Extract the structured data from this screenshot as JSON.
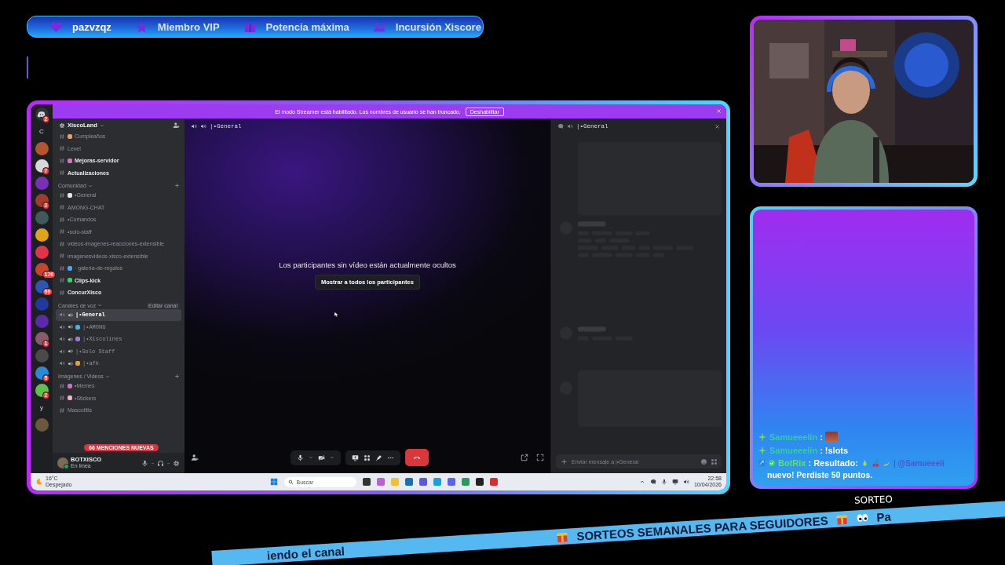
{
  "top_bar": {
    "items": [
      {
        "kind": "heart",
        "label": "pazvzqz",
        "selected": true
      },
      {
        "kind": "star",
        "label": "Miembro VIP",
        "selected": false
      },
      {
        "kind": "gift",
        "label": "Potencia máxima",
        "selected": false
      },
      {
        "kind": "group",
        "label": "Incursión Xiscore",
        "selected": false
      }
    ]
  },
  "discord": {
    "banner": {
      "text": "El modo Streamer está habilitado. Los nombres de usuario se han truncado.",
      "button": "Deshabilitar"
    },
    "servers": [
      {
        "kind": "home",
        "badge": "2"
      },
      {
        "kind": "letter",
        "label": "C"
      },
      {
        "kind": "avatar",
        "color": "#b5552e"
      },
      {
        "kind": "avatar",
        "color": "#d8d8d8",
        "badge": "7"
      },
      {
        "kind": "avatar",
        "color": "#7a2fb8"
      },
      {
        "kind": "avatar",
        "color": "#a33a2a",
        "badge": "3"
      },
      {
        "kind": "avatar",
        "color": "#3f5a5a"
      },
      {
        "kind": "avatar",
        "color": "#e0a516"
      },
      {
        "kind": "avatar",
        "color": "#e0344a"
      },
      {
        "kind": "avatar",
        "color": "#c8442c",
        "badge": "176"
      },
      {
        "kind": "avatar",
        "color": "#2a56b8",
        "badge": "66"
      },
      {
        "kind": "avatar",
        "color": "#1f3a9c"
      },
      {
        "kind": "avatar",
        "color": "#5a2aa8"
      },
      {
        "kind": "avatar",
        "color": "#8a5a6a",
        "badge": "1"
      },
      {
        "kind": "avatar",
        "color": "#4a4a4a"
      },
      {
        "kind": "avatar",
        "color": "#2a8ad8",
        "badge": "5"
      },
      {
        "kind": "avatar",
        "color": "#5fc04a",
        "badge": "2"
      },
      {
        "kind": "letter",
        "label": "y"
      },
      {
        "kind": "avatar",
        "color": "#6a5a3a"
      }
    ],
    "server_name": "XiscoLand",
    "sections": [
      {
        "channels": [
          {
            "kind": "text",
            "name": "Cumpleaños",
            "color": "#e0a070",
            "unread": false,
            "selected": false
          },
          {
            "kind": "text",
            "name": "Level",
            "unread": false,
            "selected": false
          },
          {
            "kind": "text",
            "name": "Mejoras-servidor",
            "color": "#d07ab0",
            "unread": true,
            "selected": false
          },
          {
            "kind": "text",
            "name": "Actualizaciones",
            "unread": true,
            "selected": false
          }
        ]
      },
      {
        "category": "Comunidad",
        "channels": [
          {
            "kind": "text",
            "name": "•General",
            "color": "#e8e8e8",
            "unread": false,
            "selected": false
          },
          {
            "kind": "text",
            "name": "AMONG-CHAT",
            "unread": false,
            "selected": false
          },
          {
            "kind": "text",
            "name": "•Comandos",
            "unread": false,
            "selected": false
          },
          {
            "kind": "text",
            "name": "•solo-staff",
            "unread": false,
            "selected": false
          },
          {
            "kind": "text",
            "name": "videos-imagenes-reacciones-extensible",
            "unread": false,
            "selected": false
          },
          {
            "kind": "text",
            "name": "imagenesvideos-xisco-extensible",
            "unread": false,
            "selected": false
          },
          {
            "kind": "text",
            "name": "· galería-de-regalos",
            "color": "#4aa8f0",
            "unread": false,
            "selected": false
          },
          {
            "kind": "text",
            "name": "Clips-kick",
            "color": "#3fcf6a",
            "unread": true,
            "selected": false
          },
          {
            "kind": "text",
            "name": "ConcurXisco",
            "unread": true,
            "selected": false
          }
        ]
      },
      {
        "category": "Canales de voz",
        "tooltip": "Editar canal",
        "channels": [
          {
            "kind": "voice",
            "name": "|•General",
            "unread": true,
            "selected": true
          },
          {
            "kind": "voice",
            "name": "|•AMONG",
            "color": "#4ab0e0",
            "unread": false,
            "selected": false
          },
          {
            "kind": "voice",
            "name": "|•Xiscolines",
            "color": "#9a7ad8",
            "unread": false,
            "selected": false
          },
          {
            "kind": "voice",
            "name": "|•Solo Staff",
            "unread": false,
            "selected": false
          },
          {
            "kind": "voice",
            "name": "|•afk",
            "color": "#e0a040",
            "unread": false,
            "selected": false
          }
        ]
      },
      {
        "category": "Imágenes / Videos",
        "channels": [
          {
            "kind": "text",
            "name": "•Memes",
            "color": "#d070c0",
            "unread": false,
            "selected": false
          },
          {
            "kind": "text",
            "name": "•Stickers",
            "color": "#f0b0d0",
            "unread": false,
            "selected": false
          },
          {
            "kind": "text",
            "name": "Mascotitis",
            "unread": false,
            "selected": false
          }
        ]
      }
    ],
    "mentions_pill": "66 MENCIONES NUEVAS",
    "user": {
      "name": "BOTXISCO",
      "status": "En línea"
    },
    "call": {
      "channel": "|•General",
      "notice": "Los participantes sin vídeo están actualmente ocultos",
      "show_button": "Mostrar a todos los participantes"
    },
    "chat": {
      "channel": "|•General",
      "placeholder": "Enviar mensaje a |•General"
    },
    "taskbar": {
      "temperature": "16°C",
      "weather": "Despejado",
      "search_placeholder": "Buscar",
      "time": "22:58",
      "date": "10/04/2026"
    }
  },
  "chat_overlay": {
    "messages": [
      {
        "kind": "emote",
        "user": "Samueeelin",
        "color": "#2fd0a0",
        "separator": ":"
      },
      {
        "kind": "text",
        "user": "Samueeelin",
        "color": "#2fd0a0",
        "separator": ":",
        "text": "!slots"
      },
      {
        "kind": "slots",
        "user": "BotRix",
        "color": "#5ee06a",
        "separator": ":",
        "text": "Resultado:",
        "mention": "| @Samueeeli",
        "tail": "nuevo! Perdiste 50 puntos."
      }
    ]
  },
  "ticker": {
    "label": "SORTEO",
    "lead": "iendo el canal",
    "text": "SORTEOS SEMANALES PARA SEGUIDORES",
    "tail": "Pa"
  }
}
